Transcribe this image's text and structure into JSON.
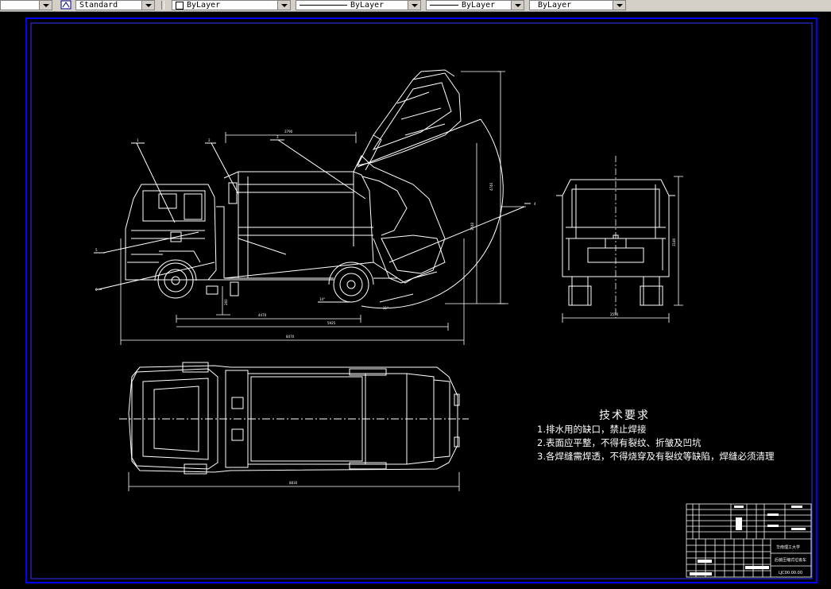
{
  "toolbar": {
    "text_style": "Standard",
    "layer": "ByLayer",
    "linetype": "ByLayer",
    "lineweight": "ByLayer",
    "plot_style": "ByLayer"
  },
  "notes": {
    "title": "技术要求",
    "lines": [
      "1.排水用的缺口，禁止焊接",
      "2.表面应平整，不得有裂纹、折皱及凹坑",
      "3.各焊缝需焊透，不得烧穿及有裂纹等缺陷，焊缝必须清理"
    ]
  },
  "title_block": {
    "school": "华南理工大学",
    "drawing_name": "后装压缩式垃圾车",
    "drawing_number": "LJC00.00.00"
  },
  "colors": {
    "background": "#000000",
    "lines": "#ffffff",
    "frame": "#0000ff",
    "toolbar": "#d4d0c8"
  }
}
